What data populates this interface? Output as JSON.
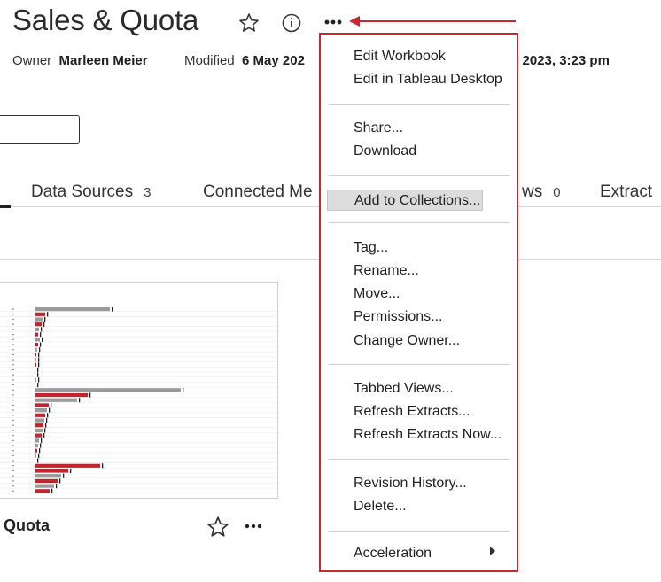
{
  "header": {
    "title": "Sales & Quota",
    "owner_label": "Owner",
    "owner_name": "Marleen Meier",
    "modified_label": "Modified",
    "modified_value": "6 May 202",
    "modified_value_right": "y 2023, 3:23 pm"
  },
  "tabs": [
    {
      "label": "Data Sources",
      "count": "3"
    },
    {
      "label": "Connected Me",
      "count": ""
    },
    {
      "label": "ws",
      "count": "0"
    },
    {
      "label": "Extract",
      "count": ""
    }
  ],
  "card": {
    "title": "Quota"
  },
  "menu": {
    "items": [
      {
        "label": "Edit Workbook"
      },
      {
        "label": "Edit in Tableau Desktop"
      },
      {
        "label": "Share..."
      },
      {
        "label": "Download"
      },
      {
        "label": "Add to Collections..."
      },
      {
        "label": "Tag..."
      },
      {
        "label": "Rename..."
      },
      {
        "label": "Move..."
      },
      {
        "label": "Permissions..."
      },
      {
        "label": "Change Owner..."
      },
      {
        "label": "Tabbed Views..."
      },
      {
        "label": "Refresh Extracts..."
      },
      {
        "label": "Refresh Extracts Now..."
      },
      {
        "label": "Revision History..."
      },
      {
        "label": "Delete..."
      },
      {
        "label": "Acceleration"
      }
    ],
    "highlighted": "Add to Collections..."
  },
  "icons": {
    "favorite": "star-icon",
    "info": "info-icon",
    "more": "more-icon",
    "submenu": "chevron-right-icon"
  },
  "colors": {
    "highlight_border": "#c8282e",
    "bar_red": "#c0262d",
    "bar_gray": "#9a9a9a",
    "menu_hover": "#dcdcdc"
  }
}
